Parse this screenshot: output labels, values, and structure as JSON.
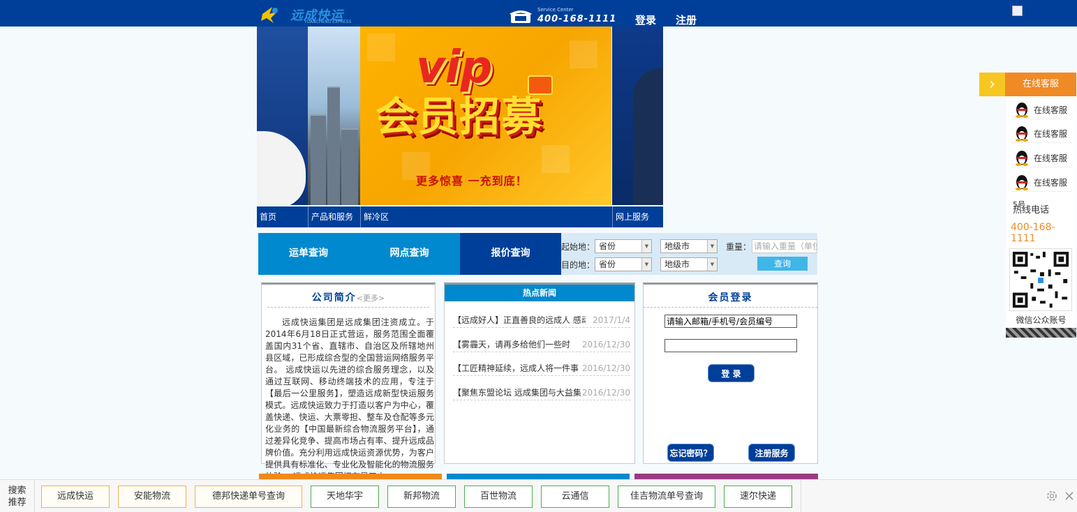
{
  "header": {
    "logo_text": "远成快运",
    "logo_sub": "YUANCHENG EXPRESS",
    "service_center_label": "Service Center",
    "phone": "400-168-1111",
    "login": "登录",
    "register": "注册"
  },
  "banner": {
    "vip": "vip",
    "headline": "会员招募",
    "slogan": "更多惊喜 一充到底！"
  },
  "nav": [
    "首页",
    "产品和服务",
    "鲜冷区",
    "网上服务"
  ],
  "query": {
    "tabs": [
      "运单查询",
      "网点查询",
      "报价查询"
    ],
    "active_tab": 2,
    "origin_label": "起始地：",
    "dest_label": "目的地：",
    "province": "省份",
    "city": "地级市",
    "weight_label": "重量：",
    "weight_placeholder": "请输入重量（单位",
    "submit": "查询"
  },
  "intro": {
    "title": "公司简介",
    "more": "<更多>",
    "body": "远成快运集团是远成集团注资成立。于2014年6月18日正式营运，服务范围全面覆盖国内31个省、直辖市、自治区及所辖地州县区域，已形成综合型的全国营运网络服务平台。 远成快运以先进的综合服务理念，以及通过互联网、移动终端技术的应用，专注于【最后一公里服务】，塑造远成新型快运服务模式。远成快运致力于打造以客户为中心，覆盖快递、快运、大票零担、整车及仓配等多元化业务的【中国最新综合物流服务平台】，通过差异化竞争、提高市场占有率、提升远成品牌价值。充分利用远成快运资源优势，为客户提供具有标准化、专业化及智能化的物流服务体验。 远成快运集团拥有员工人"
  },
  "news": {
    "title": "热点新闻",
    "items": [
      {
        "title": "【远成好人】正直善良的远成人 感动",
        "date": "2017/1/4"
      },
      {
        "title": "【雾霾天，请再多给他们一些时",
        "date": "2016/12/30"
      },
      {
        "title": "【工匠精神延续，远成人将一件事",
        "date": "2016/12/30"
      },
      {
        "title": "【聚焦东盟论坛 远成集团与大益集",
        "date": "2016/12/30"
      }
    ]
  },
  "member": {
    "title": "会员登录",
    "account_value": "请输入邮箱/手机号/会员编号",
    "password_value": "",
    "login": "登 录",
    "forgot": "忘记密码？",
    "register": "注册服务"
  },
  "float_panel": {
    "title": "在线客服",
    "qq_items": [
      "在线客服",
      "在线客服",
      "在线客服",
      "在线客服"
    ],
    "hotline_label": "热线电话",
    "hotline_overlap": "5号",
    "hotline": "400-168-1111",
    "wechat": "微信公众账号"
  },
  "bottom_bar": {
    "label": "搜索推荐",
    "chips": [
      "远成快运",
      "安能物流",
      "德邦快递单号查询",
      "天地华宇",
      "新邦物流",
      "百世物流",
      "云通信",
      "佳吉物流单号查询",
      "速尔快递"
    ]
  },
  "colors": {
    "primary": "#003f99",
    "accent_blue": "#0089cf",
    "orange": "#f08a24",
    "yellow": "#f7c620",
    "purple_bar": "#9b3a84",
    "orange_bar": "#ef8a1a"
  }
}
